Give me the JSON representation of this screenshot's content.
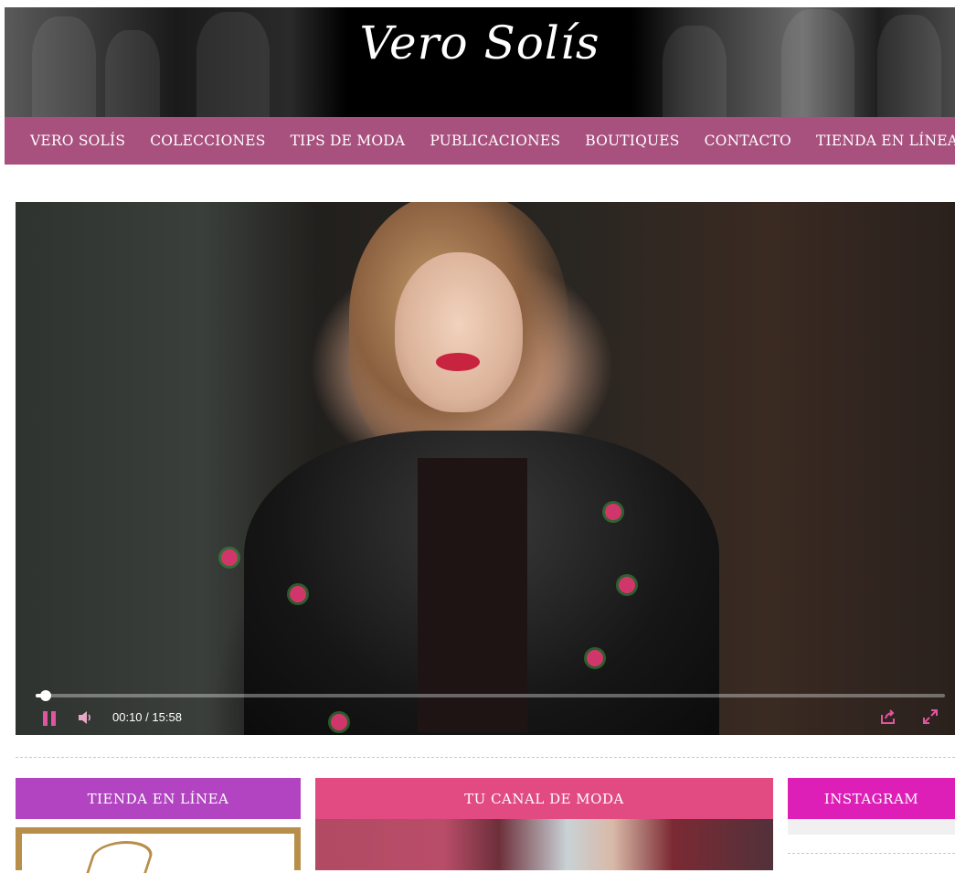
{
  "header": {
    "logo_text": "Vero Solís"
  },
  "nav": {
    "items": [
      "Vero Solís",
      "Colecciones",
      "Tips de Moda",
      "Publicaciones",
      "Boutiques",
      "Contacto",
      "Tienda en Línea"
    ]
  },
  "video": {
    "current_time": "00:10",
    "separator": "/",
    "duration": "15:58",
    "progress": 0.011,
    "state": "playing",
    "icons": [
      "pause-icon",
      "volume-icon",
      "share-icon",
      "fullscreen-icon"
    ],
    "accent_color": "#e0559f"
  },
  "widgets": {
    "tienda": {
      "title": "Tienda en Línea",
      "color": "#b244c1"
    },
    "canal": {
      "title": "Tu Canal de Moda",
      "color": "#e14b82"
    },
    "instagram": {
      "title": "Instagram",
      "color": "#dd1fb8"
    }
  },
  "colors": {
    "nav_background": "#a8507e"
  }
}
